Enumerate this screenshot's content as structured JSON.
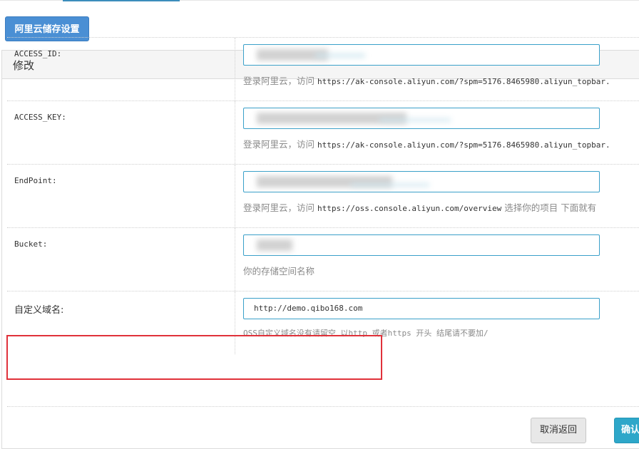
{
  "header": {
    "settings_button": "阿里云储存设置"
  },
  "panel": {
    "title": "修改"
  },
  "fields": [
    {
      "label": "ACCESS_ID:",
      "value": "",
      "help_prefix": "登录阿里云，访问 ",
      "help_url": "https://ak-console.aliyun.com/?spm=5176.8465980.aliyun_topbar.",
      "help_suffix": ""
    },
    {
      "label": "ACCESS_KEY:",
      "value": "",
      "help_prefix": "登录阿里云，访问 ",
      "help_url": "https://ak-console.aliyun.com/?spm=5176.8465980.aliyun_topbar.",
      "help_suffix": ""
    },
    {
      "label": "EndPoint:",
      "value": "",
      "help_prefix": "登录阿里云，访问 ",
      "help_url": "https://oss.console.aliyun.com/overview",
      "help_suffix": " 选择你的项目 下面就有"
    },
    {
      "label": "Bucket:",
      "value": "",
      "help_prefix": "你的存储空间名称",
      "help_url": "",
      "help_suffix": ""
    },
    {
      "label": "自定义域名:",
      "value": "http://demo.qibo168.com",
      "help_prefix": "OSS自定义域名没有请留空 以http 或者https 开头 结尾请不要加/",
      "help_url": "",
      "help_suffix": ""
    }
  ],
  "actions": {
    "cancel": "取消返回",
    "confirm": "确认"
  },
  "colors": {
    "primary_button": "#4a8fd4",
    "input_border": "#3aa0c9",
    "highlight": "#e0313a",
    "confirm_button": "#2ea7c9"
  }
}
